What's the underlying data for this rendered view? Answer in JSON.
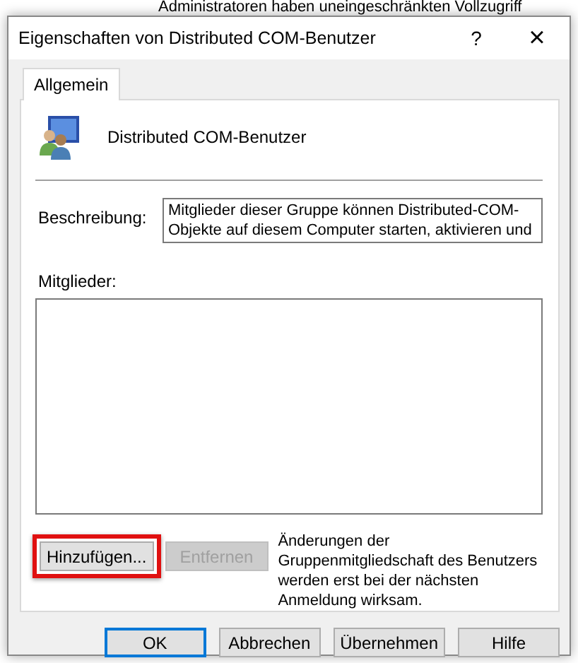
{
  "background": {
    "text": "Administratoren haben uneingeschränkten Vollzugriff"
  },
  "window": {
    "title": "Eigenschaften von Distributed COM-Benutzer",
    "help": "?",
    "close": "×"
  },
  "tabs": [
    {
      "label": "Allgemein",
      "selected": true
    }
  ],
  "group": {
    "name": "Distributed COM-Benutzer"
  },
  "description": {
    "label": "Beschreibung:",
    "lines": [
      "Mitglieder dieser Gruppe können Distributed-COM-",
      "Objekte auf diesem Computer starten, aktivieren und"
    ]
  },
  "members": {
    "label": "Mitglieder:"
  },
  "member_buttons": [
    {
      "label": "Hinzufügen...",
      "disabled": false,
      "highlighted": true
    },
    {
      "label": "Entfernen",
      "disabled": true,
      "highlighted": false
    }
  ],
  "note": "Änderungen der Gruppenmitgliedschaft des Benutzers werden erst bei der nächsten Anmeldung wirksam.",
  "buttons": [
    {
      "label": "OK",
      "default": true
    },
    {
      "label": "Abbrechen",
      "default": false
    },
    {
      "label": "Übernehmen",
      "default": false
    },
    {
      "label": "Hilfe",
      "default": false
    }
  ]
}
